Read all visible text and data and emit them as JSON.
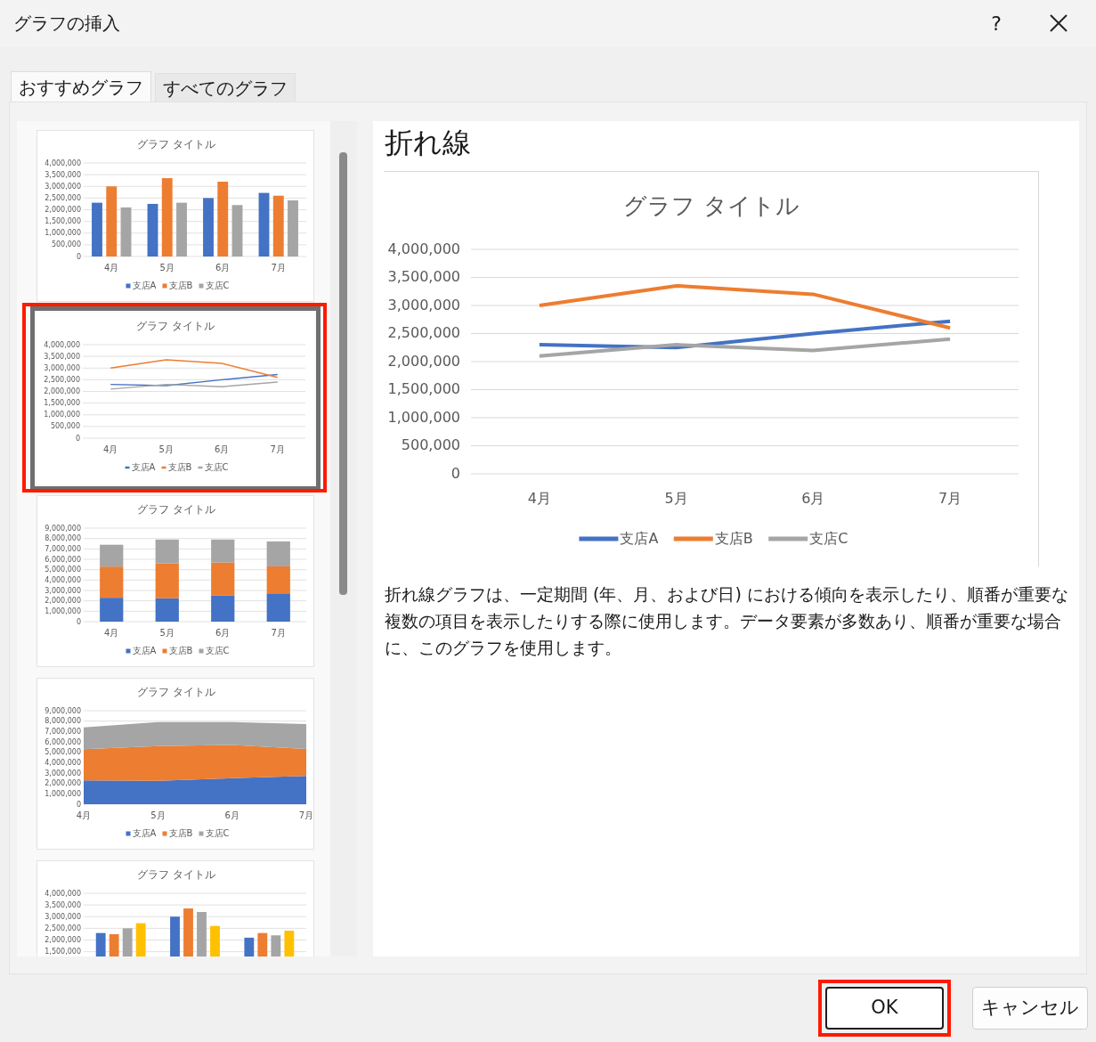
{
  "window": {
    "title": "グラフの挿入",
    "help": "?"
  },
  "tabs": [
    {
      "label": "おすすめグラフ",
      "selected": true
    },
    {
      "label": "すべてのグラフ",
      "selected": false
    }
  ],
  "thumbnails": [
    {
      "selected": false,
      "highlighted": false,
      "chart_data": {
        "type": "bar",
        "grid": true,
        "legend": "bottom",
        "title": "グラフ タイトル",
        "categories": [
          "4月",
          "5月",
          "6月",
          "7月"
        ],
        "series": [
          {
            "name": "支店A",
            "color": "#4472c4",
            "values": [
              2300000,
              2250000,
              2500000,
              2720000
            ]
          },
          {
            "name": "支店B",
            "color": "#ed7d31",
            "values": [
              3000000,
              3350000,
              3200000,
              2600000
            ]
          },
          {
            "name": "支店C",
            "color": "#a5a5a5",
            "values": [
              2100000,
              2300000,
              2200000,
              2400000
            ]
          }
        ],
        "ylim": [
          0,
          4000000
        ],
        "yticks": [
          {
            "value": 0,
            "label": "0"
          },
          {
            "value": 500000,
            "label": "500,000"
          },
          {
            "value": 1000000,
            "label": "1,000,000"
          },
          {
            "value": 1500000,
            "label": "1,500,000"
          },
          {
            "value": 2000000,
            "label": "2,000,000"
          },
          {
            "value": 2500000,
            "label": "2,500,000"
          },
          {
            "value": 3000000,
            "label": "3,000,000"
          },
          {
            "value": 3500000,
            "label": "3,500,000"
          },
          {
            "value": 4000000,
            "label": "4,000,000"
          }
        ]
      }
    },
    {
      "selected": true,
      "highlighted": true,
      "chart_data": {
        "type": "line",
        "grid": true,
        "legend": "bottom",
        "title": "グラフ タイトル",
        "categories": [
          "4月",
          "5月",
          "6月",
          "7月"
        ],
        "series": [
          {
            "name": "支店A",
            "color": "#4472c4",
            "values": [
              2300000,
              2250000,
              2500000,
              2720000
            ]
          },
          {
            "name": "支店B",
            "color": "#ed7d31",
            "values": [
              3000000,
              3350000,
              3200000,
              2600000
            ]
          },
          {
            "name": "支店C",
            "color": "#a5a5a5",
            "values": [
              2100000,
              2300000,
              2200000,
              2400000
            ]
          }
        ],
        "ylim": [
          0,
          4000000
        ],
        "yticks": [
          {
            "value": 0,
            "label": "0"
          },
          {
            "value": 500000,
            "label": "500,000"
          },
          {
            "value": 1000000,
            "label": "1,000,000"
          },
          {
            "value": 1500000,
            "label": "1,500,000"
          },
          {
            "value": 2000000,
            "label": "2,000,000"
          },
          {
            "value": 2500000,
            "label": "2,500,000"
          },
          {
            "value": 3000000,
            "label": "3,000,000"
          },
          {
            "value": 3500000,
            "label": "3,500,000"
          },
          {
            "value": 4000000,
            "label": "4,000,000"
          }
        ]
      }
    },
    {
      "selected": false,
      "highlighted": false,
      "chart_data": {
        "type": "bar",
        "stacked": true,
        "grid": true,
        "legend": "bottom",
        "title": "グラフ タイトル",
        "categories": [
          "4月",
          "5月",
          "6月",
          "7月"
        ],
        "series": [
          {
            "name": "支店A",
            "color": "#4472c4",
            "values": [
              2300000,
              2250000,
              2500000,
              2720000
            ]
          },
          {
            "name": "支店B",
            "color": "#ed7d31",
            "values": [
              3000000,
              3350000,
              3200000,
              2600000
            ]
          },
          {
            "name": "支店C",
            "color": "#a5a5a5",
            "values": [
              2100000,
              2300000,
              2200000,
              2400000
            ]
          }
        ],
        "ylim": [
          0,
          9000000
        ],
        "yticks": [
          {
            "value": 0,
            "label": "0"
          },
          {
            "value": 1000000,
            "label": "1,000,000"
          },
          {
            "value": 2000000,
            "label": "2,000,000"
          },
          {
            "value": 3000000,
            "label": "3,000,000"
          },
          {
            "value": 4000000,
            "label": "4,000,000"
          },
          {
            "value": 5000000,
            "label": "5,000,000"
          },
          {
            "value": 6000000,
            "label": "6,000,000"
          },
          {
            "value": 7000000,
            "label": "7,000,000"
          },
          {
            "value": 8000000,
            "label": "8,000,000"
          },
          {
            "value": 9000000,
            "label": "9,000,000"
          }
        ]
      }
    },
    {
      "selected": false,
      "highlighted": false,
      "chart_data": {
        "type": "area",
        "stacked": true,
        "grid": true,
        "legend": "bottom",
        "title": "グラフ タイトル",
        "categories": [
          "4月",
          "5月",
          "6月",
          "7月"
        ],
        "series": [
          {
            "name": "支店A",
            "color": "#4472c4",
            "values": [
              2300000,
              2250000,
              2500000,
              2720000
            ]
          },
          {
            "name": "支店B",
            "color": "#ed7d31",
            "values": [
              3000000,
              3350000,
              3200000,
              2600000
            ]
          },
          {
            "name": "支店C",
            "color": "#a5a5a5",
            "values": [
              2100000,
              2300000,
              2200000,
              2400000
            ]
          }
        ],
        "ylim": [
          0,
          9000000
        ],
        "yticks": [
          {
            "value": 0,
            "label": "0"
          },
          {
            "value": 1000000,
            "label": "1,000,000"
          },
          {
            "value": 2000000,
            "label": "2,000,000"
          },
          {
            "value": 3000000,
            "label": "3,000,000"
          },
          {
            "value": 4000000,
            "label": "4,000,000"
          },
          {
            "value": 5000000,
            "label": "5,000,000"
          },
          {
            "value": 6000000,
            "label": "6,000,000"
          },
          {
            "value": 7000000,
            "label": "7,000,000"
          },
          {
            "value": 8000000,
            "label": "8,000,000"
          },
          {
            "value": 9000000,
            "label": "9,000,000"
          }
        ]
      }
    },
    {
      "selected": false,
      "highlighted": false,
      "chart_data": {
        "type": "bar",
        "grid": true,
        "title": "グラフ タイトル",
        "series": [
          {
            "color": "#4472c4",
            "values": [
              2300000,
              3000000,
              2100000
            ]
          },
          {
            "color": "#ed7d31",
            "values": [
              2250000,
              3350000,
              2300000
            ]
          },
          {
            "color": "#a5a5a5",
            "values": [
              2500000,
              3200000,
              2200000
            ]
          },
          {
            "color": "#ffc000",
            "values": [
              2720000,
              2600000,
              2400000
            ]
          }
        ],
        "ylim": [
          0,
          4000000
        ],
        "yticks": [
          {
            "value": 1500000,
            "label": "1,500,000"
          },
          {
            "value": 2000000,
            "label": "2,000,000"
          },
          {
            "value": 2500000,
            "label": "2,500,000"
          },
          {
            "value": 3000000,
            "label": "3,000,000"
          },
          {
            "value": 3500000,
            "label": "3,500,000"
          },
          {
            "value": 4000000,
            "label": "4,000,000"
          }
        ]
      }
    }
  ],
  "preview": {
    "title": "折れ線",
    "chart_data": {
      "type": "line",
      "grid": true,
      "legend": "bottom",
      "title": "グラフ タイトル",
      "categories": [
        "4月",
        "5月",
        "6月",
        "7月"
      ],
      "series": [
        {
          "name": "支店A",
          "color": "#4472c4",
          "values": [
            2300000,
            2250000,
            2500000,
            2720000
          ]
        },
        {
          "name": "支店B",
          "color": "#ed7d31",
          "values": [
            3000000,
            3350000,
            3200000,
            2600000
          ]
        },
        {
          "name": "支店C",
          "color": "#a5a5a5",
          "values": [
            2100000,
            2300000,
            2200000,
            2400000
          ]
        }
      ],
      "ylim": [
        0,
        4000000
      ],
      "yticks": [
        {
          "value": 0,
          "label": "0"
        },
        {
          "value": 500000,
          "label": "500,000"
        },
        {
          "value": 1000000,
          "label": "1,000,000"
        },
        {
          "value": 1500000,
          "label": "1,500,000"
        },
        {
          "value": 2000000,
          "label": "2,000,000"
        },
        {
          "value": 2500000,
          "label": "2,500,000"
        },
        {
          "value": 3000000,
          "label": "3,000,000"
        },
        {
          "value": 3500000,
          "label": "3,500,000"
        },
        {
          "value": 4000000,
          "label": "4,000,000"
        }
      ]
    },
    "description": "折れ線グラフは、一定期間 (年、月、および日) における傾向を表示したり、順番が重要な複数の項目を表示したりする際に使用します。データ要素が多数あり、順番が重要な場合に、このグラフを使用します。"
  },
  "buttons": [
    {
      "label": "OK",
      "kind": "primary",
      "highlighted": true
    },
    {
      "label": "キャンセル",
      "kind": "secondary",
      "highlighted": false
    }
  ]
}
